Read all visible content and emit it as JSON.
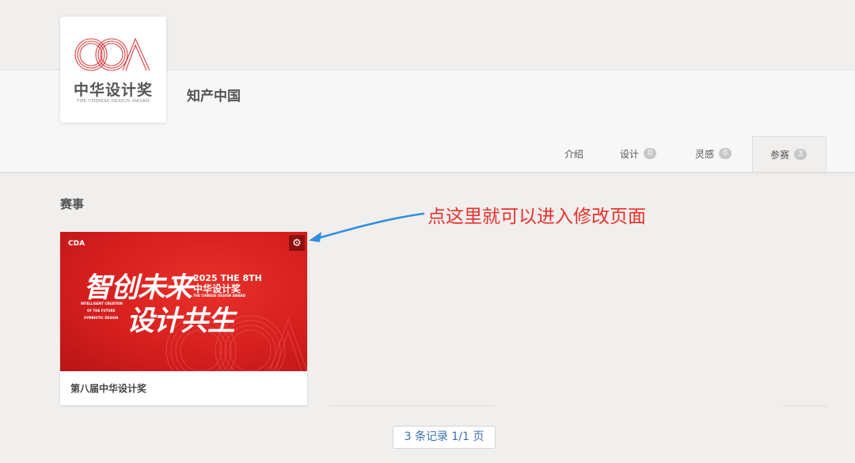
{
  "logo": {
    "mark_letters": "CDA",
    "name_cn": "中华设计奖",
    "name_en": "THE CHINESE DESIGN AWARD",
    "brand_color": "#d8282a"
  },
  "org": {
    "name": "知产中国"
  },
  "tabs": [
    {
      "label": "介绍",
      "badge": null
    },
    {
      "label": "设计",
      "badge": "0"
    },
    {
      "label": "灵感",
      "badge": "0"
    },
    {
      "label": "参赛",
      "badge": "3",
      "active": true
    }
  ],
  "section": {
    "title": "赛事"
  },
  "annotation": {
    "text": "点这里就可以进入修改页面",
    "color": "#e8312b",
    "arrow_color": "#2e8fe0"
  },
  "card": {
    "icon": "gear-icon",
    "poster": {
      "brand": "CDA",
      "headline_1": "智创未来",
      "headline_2": "设计共生",
      "year_line": "2025 THE 8TH",
      "edition_line": "中华设计奖",
      "edition_sub": "THE CHINESE DESIGN AWARD",
      "slogan_en_1": "INTELLIGENT CREATION",
      "slogan_en_2": "OF THE FUTURE",
      "slogan_en_3": "SYMBIOTIC DESIGN",
      "watermark": "CDA"
    },
    "caption": "第八届中华设计奖"
  },
  "pagination": {
    "text": "3 条记录 1/1 页"
  }
}
